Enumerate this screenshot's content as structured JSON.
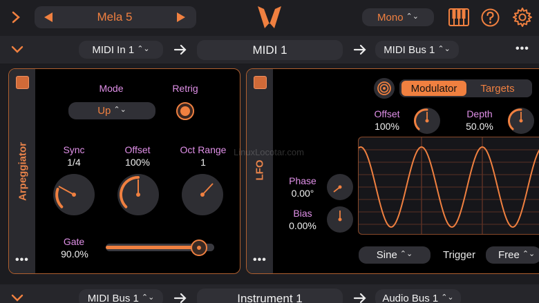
{
  "topbar": {
    "preset_name": "Mela 5",
    "mode_label": "Mono"
  },
  "route1": {
    "input": "MIDI In 1",
    "title": "MIDI 1",
    "output": "MIDI Bus 1"
  },
  "arp": {
    "vertical_label": "Arpeggiator",
    "mode_label": "Mode",
    "mode_value": "Up",
    "retrig_label": "Retrig",
    "sync_label": "Sync",
    "sync_value": "1/4",
    "offset_label": "Offset",
    "offset_value": "100%",
    "octrange_label": "Oct Range",
    "octrange_value": "1",
    "gate_label": "Gate",
    "gate_value": "90.0%",
    "gate_level": 0.9
  },
  "lfo": {
    "vertical_label": "LFO",
    "tab_modulator": "Modulator",
    "tab_targets": "Targets",
    "offset_label": "Offset",
    "offset_value": "100%",
    "depth_label": "Depth",
    "depth_value": "50.0%",
    "phase_label": "Phase",
    "phase_value": "0.00°",
    "bias_label": "Bias",
    "bias_value": "0.00%",
    "wave_value": "Sine",
    "trigger_label": "Trigger",
    "trigger_value": "Free"
  },
  "route2": {
    "input": "MIDI Bus 1",
    "title": "Instrument 1",
    "output": "Audio Bus 1"
  },
  "watermark": "LinuxLocotar.com",
  "colors": {
    "accent": "#f08040",
    "label_pink": "#e090e8",
    "panel_border": "#b06030"
  },
  "icons": [
    "chevron-right-icon",
    "triangle-left-icon",
    "triangle-right-icon",
    "fox-logo-icon",
    "piano-keys-icon",
    "help-icon",
    "gear-icon",
    "chevron-down-icon",
    "arrow-right-icon",
    "more-dots-icon",
    "target-icon"
  ]
}
